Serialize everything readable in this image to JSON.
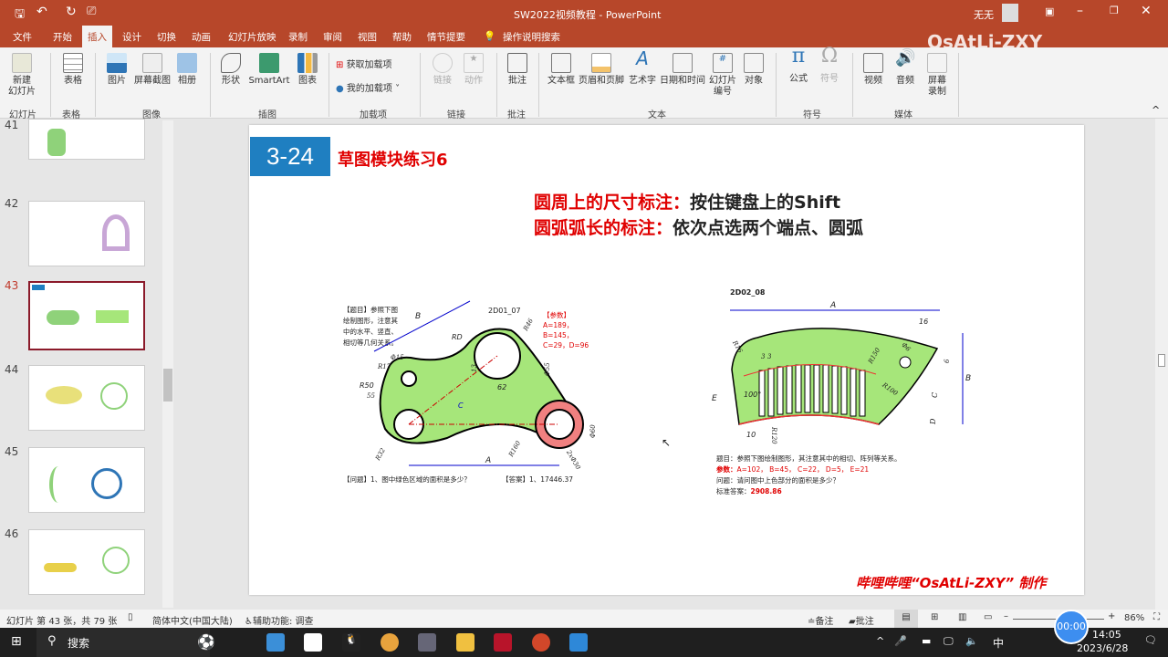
{
  "titlebar": {
    "title": "SW2022视频教程 - PowerPoint",
    "user": "无无",
    "watermark": "OsAtLi-ZXY"
  },
  "tabs": [
    "文件",
    "开始",
    "插入",
    "设计",
    "切换",
    "动画",
    "幻灯片放映",
    "录制",
    "审阅",
    "视图",
    "帮助",
    "情节提要",
    "操作说明搜索"
  ],
  "ribbon": {
    "buttons": [
      "新建\n幻灯片",
      "表格",
      "图片",
      "屏幕截图",
      "相册",
      "形状",
      "SmartArt",
      "图表",
      "获取加载项",
      "我的加载项",
      "链接",
      "动作",
      "批注",
      "文本框",
      "页眉和页脚",
      "艺术字",
      "日期和时间",
      "幻灯片\n编号",
      "对象",
      "公式",
      "符号",
      "视频",
      "音频",
      "屏幕\n录制"
    ],
    "groups": [
      "幻灯片",
      "表格",
      "图像",
      "插图",
      "加载项",
      "链接",
      "批注",
      "文本",
      "符号",
      "媒体"
    ]
  },
  "thumbnails": [
    {
      "num": "41"
    },
    {
      "num": "42"
    },
    {
      "num": "43",
      "selected": true
    },
    {
      "num": "44"
    },
    {
      "num": "45"
    },
    {
      "num": "46"
    }
  ],
  "slide": {
    "badge": "3-24",
    "title": "草图模块练习6",
    "line1_red": "圆周上的尺寸标注：",
    "line1_black": "按住键盘上的Shift",
    "line2_red": "圆弧弧长的标注：",
    "line2_black": "依次点选两个端点、圆弧",
    "left": {
      "code": "2D01_07",
      "task": "【题目】参照下图绘制图形，注意其中的水平、竖直、相切等几何关系。",
      "params_title": "【参数】",
      "params": "A=189，B=145，C=29，D=96",
      "question": "【问题】1、图中绿色区域的面积是多少？",
      "answer": "【答案】1、17446.37",
      "dims": [
        "B",
        "RD",
        "R46",
        "Φ15",
        "R17",
        "55",
        "R50",
        "13",
        "Φ55",
        "62",
        "C",
        "Φ60",
        "R32",
        "R160",
        "2xΦ30",
        "A"
      ]
    },
    "right": {
      "code": "2D02_08",
      "task": "题目：参照下图绘制图形，其注意其中的相切、阵列等关系。",
      "params_label": "参数：",
      "params": "A=102， B=45， C=22， D=5， E=21",
      "question": "问题：请问图中上色部分的面积是多少？",
      "answer_label": "标准答案：",
      "answer": "2908.86",
      "dims": [
        "A",
        "16",
        "R16",
        "R150",
        "Φ6",
        "6",
        "B",
        "3",
        "3",
        "100°",
        "R100",
        "C",
        "D",
        "E",
        "10",
        "R120"
      ]
    },
    "footer": "哔哩哔哩“OsAtLi-ZXY” 制作"
  },
  "status": {
    "slide_info": "幻灯片 第 43 张，共 79 张",
    "language": "简体中文(中国大陆)",
    "accessibility": "辅助功能: 调查",
    "notes": "备注",
    "comments": "批注",
    "zoom": "86%",
    "timer": "00:00"
  },
  "taskbar": {
    "search": "搜索",
    "time": "14:05",
    "date": "2023/6/28",
    "ime": "中"
  },
  "colors": {
    "accent": "#b7472a",
    "badge": "#1f7fc1",
    "green": "#a6e67a",
    "pink": "#f08080"
  }
}
